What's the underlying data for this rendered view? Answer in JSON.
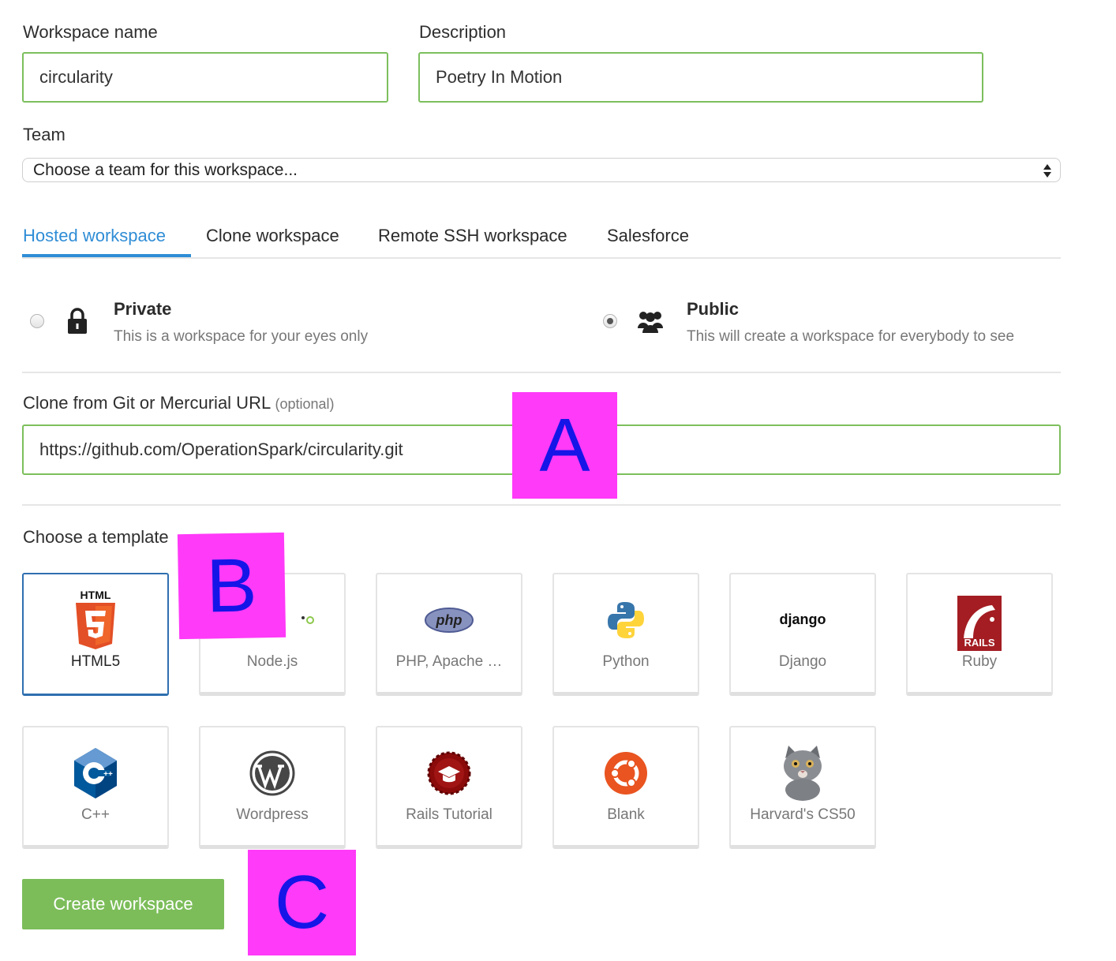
{
  "workspace_name": {
    "label": "Workspace name",
    "value": "circularity"
  },
  "description": {
    "label": "Description",
    "value": "Poetry In Motion"
  },
  "team": {
    "label": "Team",
    "selected": "Choose a team for this workspace..."
  },
  "tabs": [
    {
      "label": "Hosted workspace",
      "active": true
    },
    {
      "label": "Clone workspace",
      "active": false
    },
    {
      "label": "Remote SSH workspace",
      "active": false
    },
    {
      "label": "Salesforce",
      "active": false
    }
  ],
  "visibility": {
    "private": {
      "title": "Private",
      "desc": "This is a workspace for your eyes only",
      "icon": "lock-icon",
      "selected": false
    },
    "public": {
      "title": "Public",
      "desc": "This will create a workspace for everybody to see",
      "icon": "users-icon",
      "selected": true
    }
  },
  "clone": {
    "label": "Clone from Git or Mercurial URL",
    "optional": "(optional)",
    "value": "https://github.com/OperationSpark/circularity.git"
  },
  "templates": {
    "label": "Choose a template",
    "items": [
      {
        "name": "HTML5",
        "icon": "html5-icon",
        "logo_text": "HTML",
        "selected": true
      },
      {
        "name": "Node.js",
        "icon": "nodejs-icon",
        "selected": false
      },
      {
        "name": "PHP, Apache …",
        "icon": "php-icon",
        "logo_text": "php",
        "selected": false
      },
      {
        "name": "Python",
        "icon": "python-icon",
        "selected": false
      },
      {
        "name": "Django",
        "icon": "django-icon",
        "logo_text": "django",
        "selected": false
      },
      {
        "name": "Ruby",
        "icon": "rails-icon",
        "logo_text": "RAILS",
        "selected": false
      },
      {
        "name": "C++",
        "icon": "cpp-icon",
        "selected": false
      },
      {
        "name": "Wordpress",
        "icon": "wordpress-icon",
        "selected": false
      },
      {
        "name": "Rails Tutorial",
        "icon": "rails-tutorial-icon",
        "selected": false
      },
      {
        "name": "Blank",
        "icon": "ubuntu-icon",
        "selected": false
      },
      {
        "name": "Harvard's CS50",
        "icon": "cat-icon",
        "selected": false
      }
    ]
  },
  "create_button": "Create workspace",
  "markers": {
    "a": "A",
    "b": "B",
    "c": "C"
  },
  "colors": {
    "accent": "#2f8dd6",
    "input_border": "#7cbf5d",
    "button": "#7cbd5a",
    "marker_bg": "#ff3af8",
    "marker_text": "#1515e8"
  }
}
